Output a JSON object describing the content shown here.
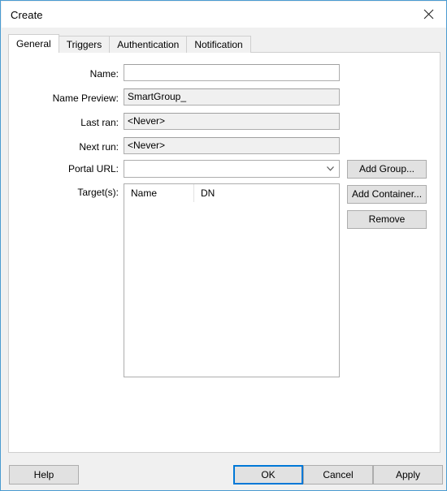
{
  "window": {
    "title": "Create",
    "close_icon": "close-icon"
  },
  "tabs": [
    {
      "label": "General",
      "active": true
    },
    {
      "label": "Triggers",
      "active": false
    },
    {
      "label": "Authentication",
      "active": false
    },
    {
      "label": "Notification",
      "active": false
    }
  ],
  "form": {
    "name": {
      "label": "Name:",
      "value": "",
      "readonly": false
    },
    "name_preview": {
      "label": "Name Preview:",
      "value": "SmartGroup_",
      "readonly": true
    },
    "last_ran": {
      "label": "Last ran:",
      "value": "<Never>",
      "readonly": true
    },
    "next_run": {
      "label": "Next run:",
      "value": "<Never>",
      "readonly": true
    },
    "portal_url": {
      "label": "Portal URL:",
      "value": "",
      "arrow_icon": "chevron-down-icon"
    },
    "targets": {
      "label": "Target(s):",
      "columns": [
        "Name",
        "DN"
      ],
      "rows": []
    }
  },
  "side_buttons": [
    {
      "label": "Add Group..."
    },
    {
      "label": "Add Container..."
    },
    {
      "label": "Remove"
    }
  ],
  "bottom_buttons": {
    "help": "Help",
    "ok": "OK",
    "cancel": "Cancel",
    "apply": "Apply"
  },
  "colors": {
    "window_border": "#4a9bd1",
    "focus_ring": "#0078d7",
    "dialog_bg": "#f0f0f0",
    "panel_bg": "#ffffff",
    "button_bg": "#e1e1e1",
    "readonly_bg": "#f0f0f0"
  }
}
